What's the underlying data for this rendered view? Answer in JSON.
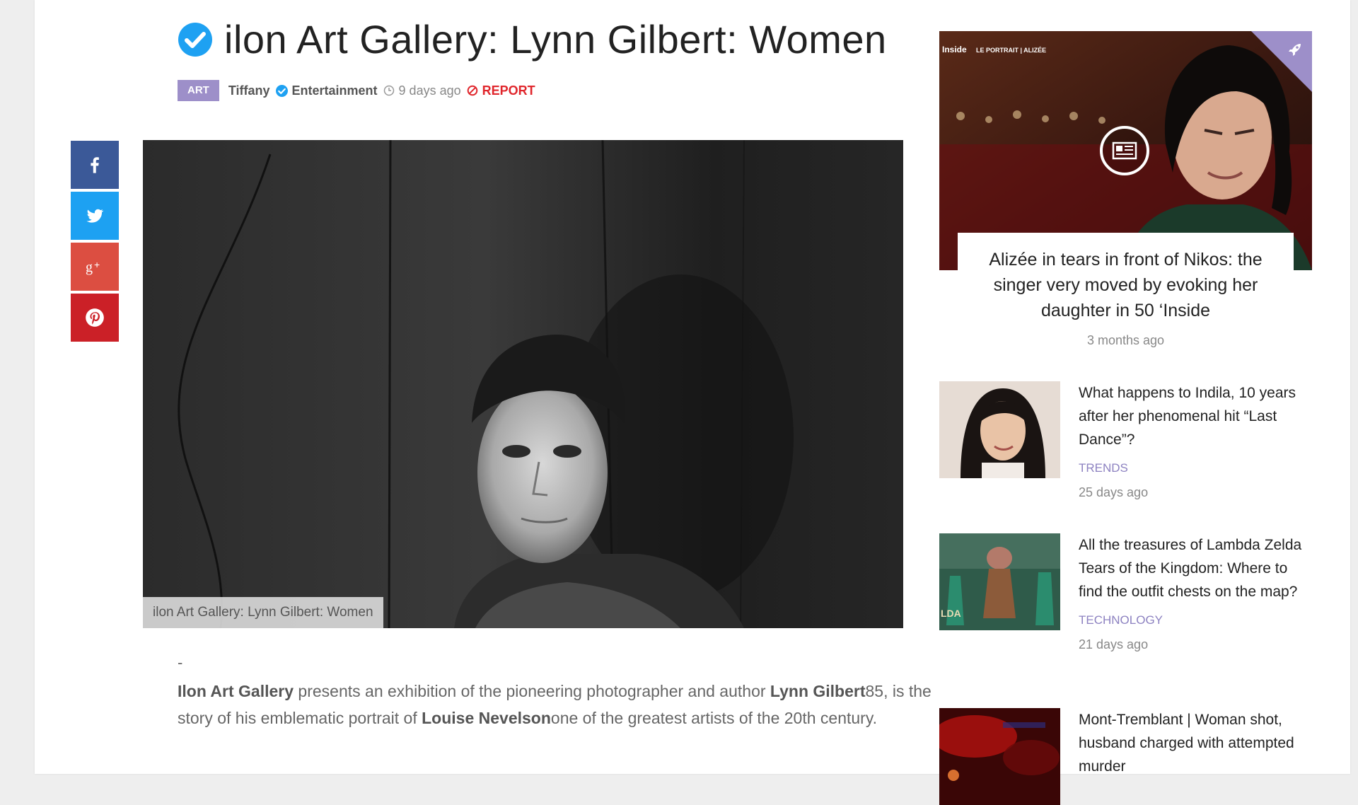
{
  "article": {
    "title": "ilon Art Gallery: Lynn Gilbert: Women",
    "category": "ART",
    "author": "Tiffany",
    "section": "Entertainment",
    "time": "9 days ago",
    "report_label": "REPORT",
    "image_caption": "ilon Art Gallery: Lynn Gilbert: Women",
    "dash": "-",
    "body": {
      "p1": "Ilon Art Gallery",
      "p2": " presents an exhibition of the pioneering photographer and author ",
      "p3": "Lynn Gilbert",
      "p4": "85, is the story of his emblematic portrait of ",
      "p5": "Louise Nevelson",
      "p6": "one of the greatest artists of the 20th century."
    }
  },
  "share": [
    "facebook-icon",
    "twitter-icon",
    "google-plus-icon",
    "pinterest-icon"
  ],
  "sidebar": {
    "featured": {
      "title": "Alizée in tears in front of Nikos: the singer very moved by evoking her daughter in 50 ‘Inside",
      "time": "3 months ago",
      "overlay_text": "Inside",
      "overlay_small": "LE PORTRAIT | ALIZÉE"
    },
    "items": [
      {
        "title": "What happens to Indila, 10 years after her phenomenal hit “Last Dance”?",
        "category": "TRENDS",
        "time": "25 days ago"
      },
      {
        "title": "All the treasures of Lambda Zelda Tears of the Kingdom: Where to find the outfit chests on the map?",
        "category": "TECHNOLOGY",
        "time": "21 days ago"
      },
      {
        "title": "Mont-Tremblant | Woman shot, husband charged with attempted murder",
        "category": "",
        "time": ""
      }
    ]
  },
  "colors": {
    "category_badge": "#9d8fc9",
    "verified": "#1ea1f2",
    "report": "#e0262c",
    "facebook": "#3b5998",
    "twitter": "#1da1f2",
    "google_plus": "#dc4e41",
    "pinterest": "#cb2027"
  }
}
